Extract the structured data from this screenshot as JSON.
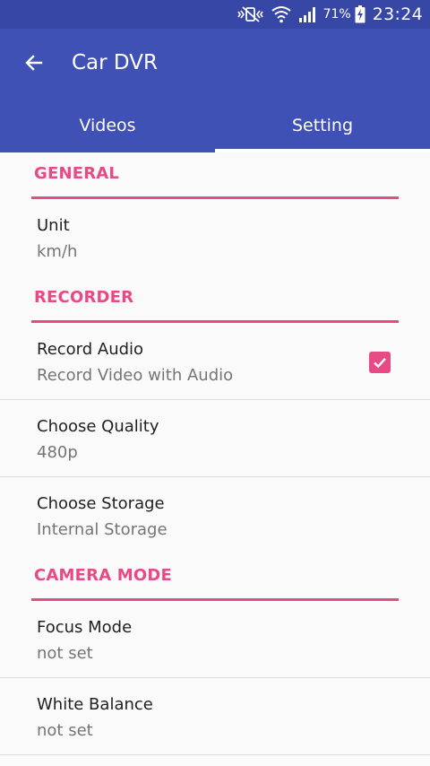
{
  "status_bar": {
    "battery_percent": "71%",
    "time": "23:24",
    "icons": [
      "mute-vibrate-icon",
      "wifi-icon",
      "signal-icon",
      "battery-charging-icon"
    ]
  },
  "app_bar": {
    "title": "Car DVR",
    "back_icon": "arrow-back-icon",
    "background_color": "#3f51b5",
    "status_bar_color": "#3647a6"
  },
  "tabs": [
    {
      "label": "Videos",
      "active": false
    },
    {
      "label": "Setting",
      "active": true
    }
  ],
  "accent_color": "#e84a85",
  "sections": {
    "general": {
      "title": "GENERAL",
      "items": [
        {
          "title": "Unit",
          "summary": "km/h"
        }
      ]
    },
    "recorder": {
      "title": "RECORDER",
      "items": [
        {
          "title": "Record Audio",
          "summary": "Record Video with Audio",
          "checked": true
        },
        {
          "title": "Choose Quality",
          "summary": "480p"
        },
        {
          "title": "Choose Storage",
          "summary": "Internal Storage"
        }
      ]
    },
    "camera_mode": {
      "title": "CAMERA MODE",
      "items": [
        {
          "title": "Focus Mode",
          "summary": "not set"
        },
        {
          "title": "White Balance",
          "summary": "not set"
        }
      ]
    }
  }
}
